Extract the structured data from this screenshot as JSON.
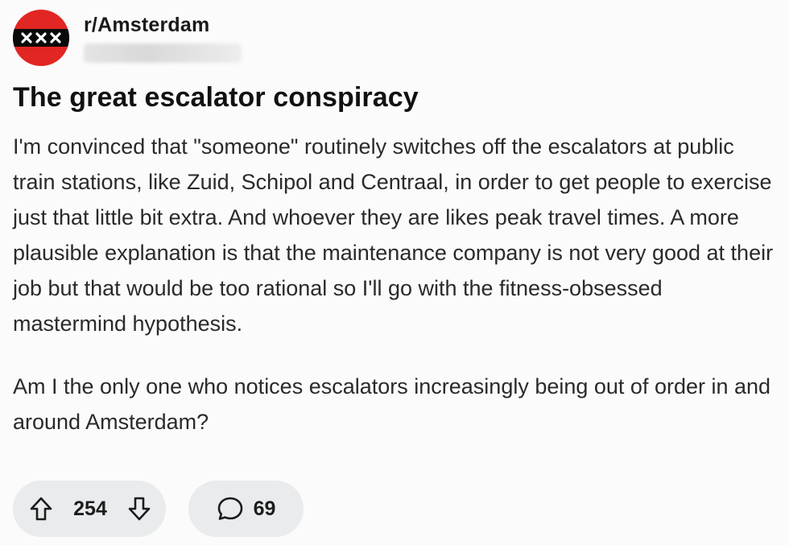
{
  "post": {
    "subreddit": "r/Amsterdam",
    "title": "The great escalator conspiracy",
    "paragraphs": [
      "I'm convinced that \"someone\" routinely switches off the escalators at public train stations, like Zuid, Schipol and Centraal, in order to get people to exercise just that little bit extra. And whoever they are likes peak travel times. A more plausible explanation is that the maintenance company is not very good at their job but that would be too rational so I'll go with the fitness-obsessed mastermind hypothesis.",
      "Am I the only one who notices escalators increasingly being out of order in and around Amsterdam?"
    ]
  },
  "actions": {
    "score": "254",
    "comments": "69"
  },
  "icons": {
    "avatar": "amsterdam-flag-icon",
    "upvote": "arrow-up-icon",
    "downvote": "arrow-down-icon",
    "comment": "speech-bubble-icon"
  },
  "colors": {
    "avatar_red": "#e12623",
    "avatar_band": "#0a0a0a",
    "pill_bg": "#e9ebed"
  }
}
